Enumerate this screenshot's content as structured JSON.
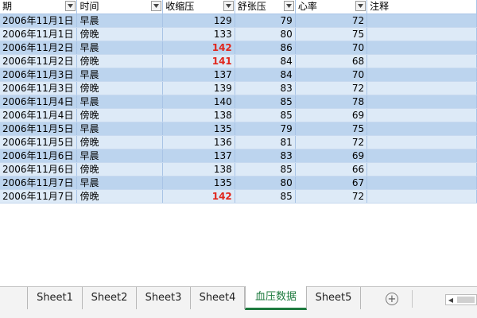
{
  "headers": [
    "期",
    "时间",
    "收缩压",
    "舒张压",
    "心率",
    "注释"
  ],
  "rows": [
    {
      "date": "2006年11月1日",
      "time": "早晨",
      "systolic": "129",
      "diastolic": "79",
      "heart_rate": "72",
      "high": false
    },
    {
      "date": "2006年11月1日",
      "time": "傍晚",
      "systolic": "133",
      "diastolic": "80",
      "heart_rate": "75",
      "high": false
    },
    {
      "date": "2006年11月2日",
      "time": "早晨",
      "systolic": "142",
      "diastolic": "86",
      "heart_rate": "70",
      "high": true
    },
    {
      "date": "2006年11月2日",
      "time": "傍晚",
      "systolic": "141",
      "diastolic": "84",
      "heart_rate": "68",
      "high": true
    },
    {
      "date": "2006年11月3日",
      "time": "早晨",
      "systolic": "137",
      "diastolic": "84",
      "heart_rate": "70",
      "high": false
    },
    {
      "date": "2006年11月3日",
      "time": "傍晚",
      "systolic": "139",
      "diastolic": "83",
      "heart_rate": "72",
      "high": false
    },
    {
      "date": "2006年11月4日",
      "time": "早晨",
      "systolic": "140",
      "diastolic": "85",
      "heart_rate": "78",
      "high": false
    },
    {
      "date": "2006年11月4日",
      "time": "傍晚",
      "systolic": "138",
      "diastolic": "85",
      "heart_rate": "69",
      "high": false
    },
    {
      "date": "2006年11月5日",
      "time": "早晨",
      "systolic": "135",
      "diastolic": "79",
      "heart_rate": "75",
      "high": false
    },
    {
      "date": "2006年11月5日",
      "time": "傍晚",
      "systolic": "136",
      "diastolic": "81",
      "heart_rate": "72",
      "high": false
    },
    {
      "date": "2006年11月6日",
      "time": "早晨",
      "systolic": "137",
      "diastolic": "83",
      "heart_rate": "69",
      "high": false
    },
    {
      "date": "2006年11月6日",
      "time": "傍晚",
      "systolic": "138",
      "diastolic": "85",
      "heart_rate": "66",
      "high": false
    },
    {
      "date": "2006年11月7日",
      "time": "早晨",
      "systolic": "135",
      "diastolic": "80",
      "heart_rate": "67",
      "high": false
    },
    {
      "date": "2006年11月7日",
      "time": "傍晚",
      "systolic": "142",
      "diastolic": "85",
      "heart_rate": "72",
      "high": true
    }
  ],
  "sheet_tabs": [
    "Sheet1",
    "Sheet2",
    "Sheet3",
    "Sheet4",
    "血压数据",
    "Sheet5"
  ],
  "active_tab": "血压数据",
  "add_sheet_symbol": "+",
  "scroll_left_symbol": "◀",
  "colors": {
    "high_value": "#e0261c",
    "row_band_dark": "#bcd4ee",
    "row_band_light": "#ddeaf7",
    "active_tab_accent": "#1d7a3e"
  }
}
